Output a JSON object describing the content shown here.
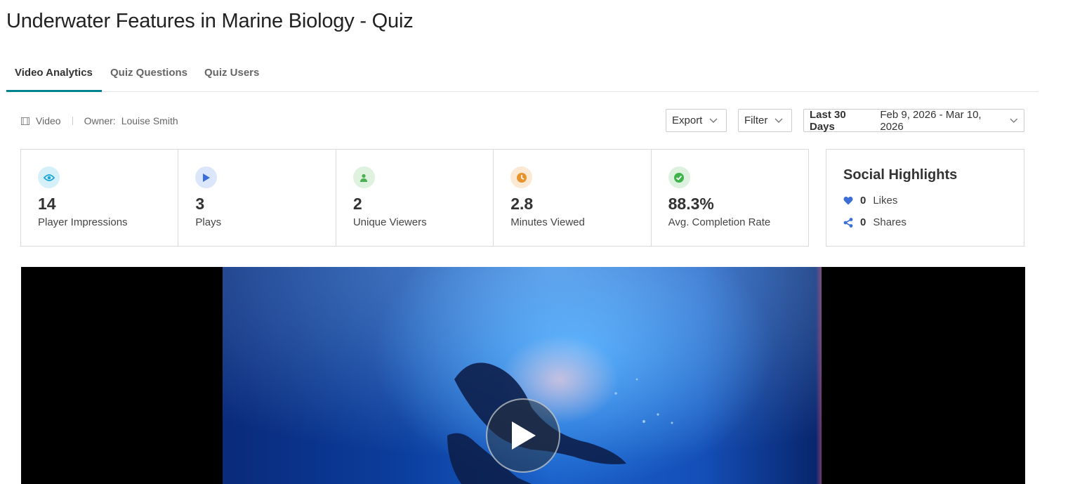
{
  "page": {
    "title": "Underwater Features in Marine Biology - Quiz"
  },
  "tabs": [
    {
      "label": "Video Analytics",
      "active": true
    },
    {
      "label": "Quiz Questions",
      "active": false
    },
    {
      "label": "Quiz Users",
      "active": false
    }
  ],
  "meta": {
    "type_label": "Video",
    "owner_label": "Owner:",
    "owner_name": "Louise Smith"
  },
  "toolbar": {
    "export_label": "Export",
    "filter_label": "Filter",
    "date_range_label": "Last 30 Days",
    "date_range_value": "Feb 9, 2026 - Mar 10, 2026"
  },
  "stats": [
    {
      "value": "14",
      "label": "Player Impressions",
      "icon": "eye-icon",
      "color": "#1ba6d6",
      "bg": "#d6f0fa"
    },
    {
      "value": "3",
      "label": "Plays",
      "icon": "play-icon",
      "color": "#3a6fd8",
      "bg": "#dce6fa"
    },
    {
      "value": "2",
      "label": "Unique Viewers",
      "icon": "user-icon",
      "color": "#4caf50",
      "bg": "#dff2df"
    },
    {
      "value": "2.8",
      "label": "Minutes Viewed",
      "icon": "clock-icon",
      "color": "#e8942e",
      "bg": "#fbe9d4"
    },
    {
      "value": "88.3%",
      "label": "Avg. Completion Rate",
      "icon": "check-circle-icon",
      "color": "#3db34a",
      "bg": "#ddf2de"
    }
  ],
  "social": {
    "title": "Social Highlights",
    "likes_count": "0",
    "likes_label": "Likes",
    "shares_count": "0",
    "shares_label": "Shares",
    "accent": "#3b6fd6"
  },
  "player": {
    "play_icon": "play-button-icon"
  },
  "colors": {
    "tab_accent": "#00838f"
  }
}
